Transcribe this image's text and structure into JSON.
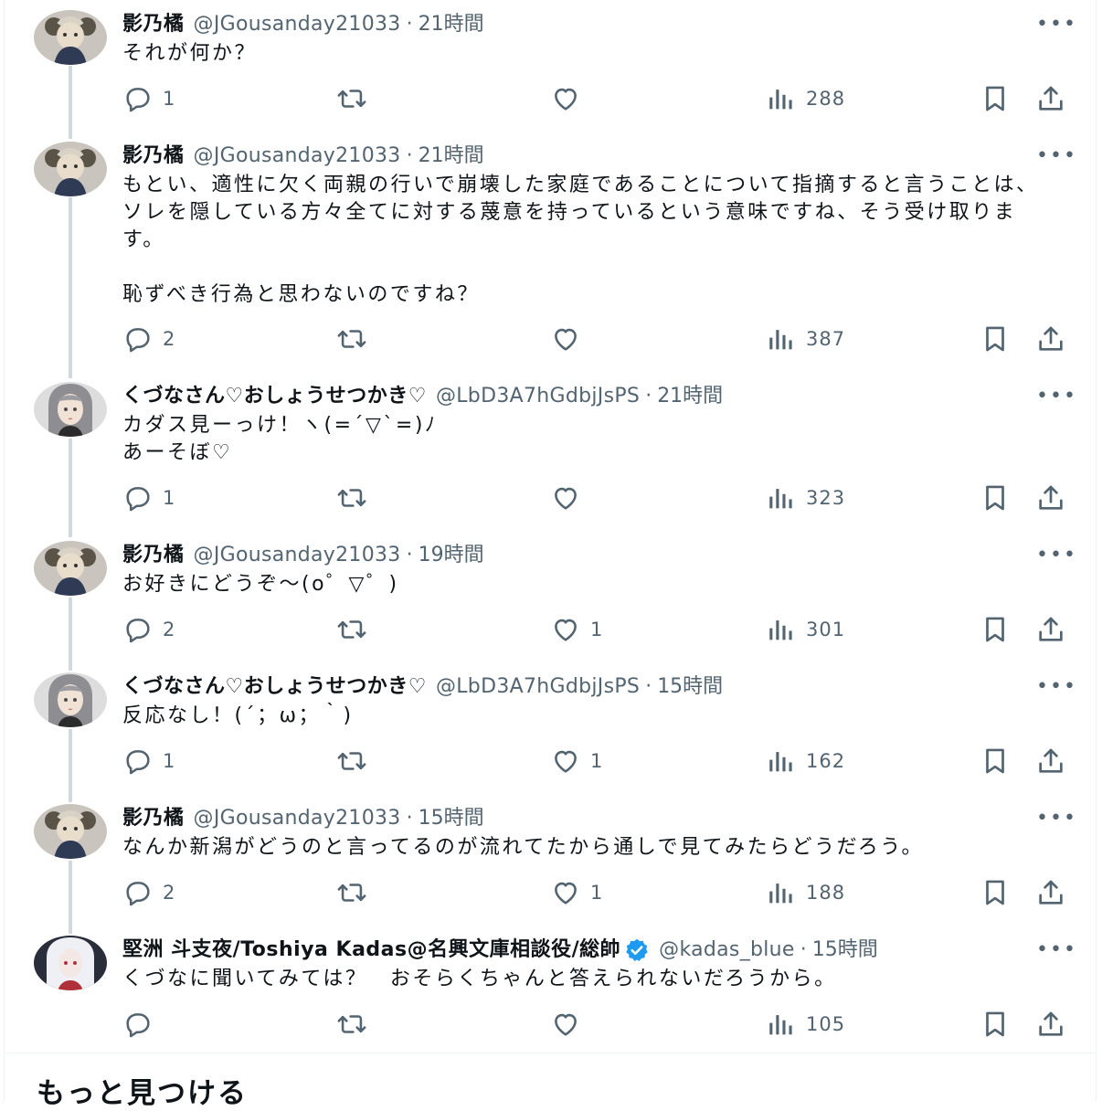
{
  "tweets": [
    {
      "name": "影乃橘",
      "handle": "@JGousanday21033",
      "time": "21時間",
      "text": "それが何か？",
      "replies": "1",
      "retweets": "",
      "likes": "",
      "views": "288",
      "avatar": "avatar-steampunk-character"
    },
    {
      "name": "影乃橘",
      "handle": "@JGousanday21033",
      "time": "21時間",
      "text": "もとい、適性に欠く両親の行いで崩壊した家庭であることについて指摘すると言うことは、ソレを隠している方々全てに対する蔑意を持っているという意味ですね、そう受け取ります。\n\n恥ずべき行為と思わないのですね？",
      "replies": "2",
      "retweets": "",
      "likes": "",
      "views": "387",
      "avatar": "avatar-steampunk-character"
    },
    {
      "name": "くづなさん♡おしょうせつかき♡",
      "handle": "@LbD3A7hGdbjJsPS",
      "time": "21時間",
      "text": "カダス見ーっけ！ヽ(=´▽`=)ﾉ\nあーそぼ♡",
      "replies": "1",
      "retweets": "",
      "likes": "",
      "views": "323",
      "avatar": "avatar-gray-hair-girl"
    },
    {
      "name": "影乃橘",
      "handle": "@JGousanday21033",
      "time": "19時間",
      "text": "お好きにどうぞ〜(o゜▽゜)",
      "replies": "2",
      "retweets": "",
      "likes": "1",
      "views": "301",
      "avatar": "avatar-steampunk-character"
    },
    {
      "name": "くづなさん♡おしょうせつかき♡",
      "handle": "@LbD3A7hGdbjJsPS",
      "time": "15時間",
      "text": "反応なし！(´；ω；｀)",
      "replies": "1",
      "retweets": "",
      "likes": "1",
      "views": "162",
      "avatar": "avatar-gray-hair-girl"
    },
    {
      "name": "影乃橘",
      "handle": "@JGousanday21033",
      "time": "15時間",
      "text": "なんか新潟がどうのと言ってるのが流れてたから通しで見てみたらどうだろう。",
      "replies": "2",
      "retweets": "",
      "likes": "1",
      "views": "188",
      "avatar": "avatar-steampunk-character"
    },
    {
      "name": "堅洲 斗支夜/Toshiya Kadas@名興文庫相談役/総帥",
      "handle": "@kadas_blue",
      "time": "15時間",
      "text": "くづなに聞いてみては？　おそらくちゃんと答えられないだろうから。",
      "replies": "",
      "retweets": "",
      "likes": "",
      "views": "105",
      "avatar": "avatar-white-hair-girl",
      "verified": true
    }
  ],
  "discover": {
    "title": "もっと見つける"
  },
  "colors": {
    "text": "#0f1419",
    "secondary": "#536471",
    "thread": "#cfd9de",
    "verified": "#1d9bf0"
  }
}
